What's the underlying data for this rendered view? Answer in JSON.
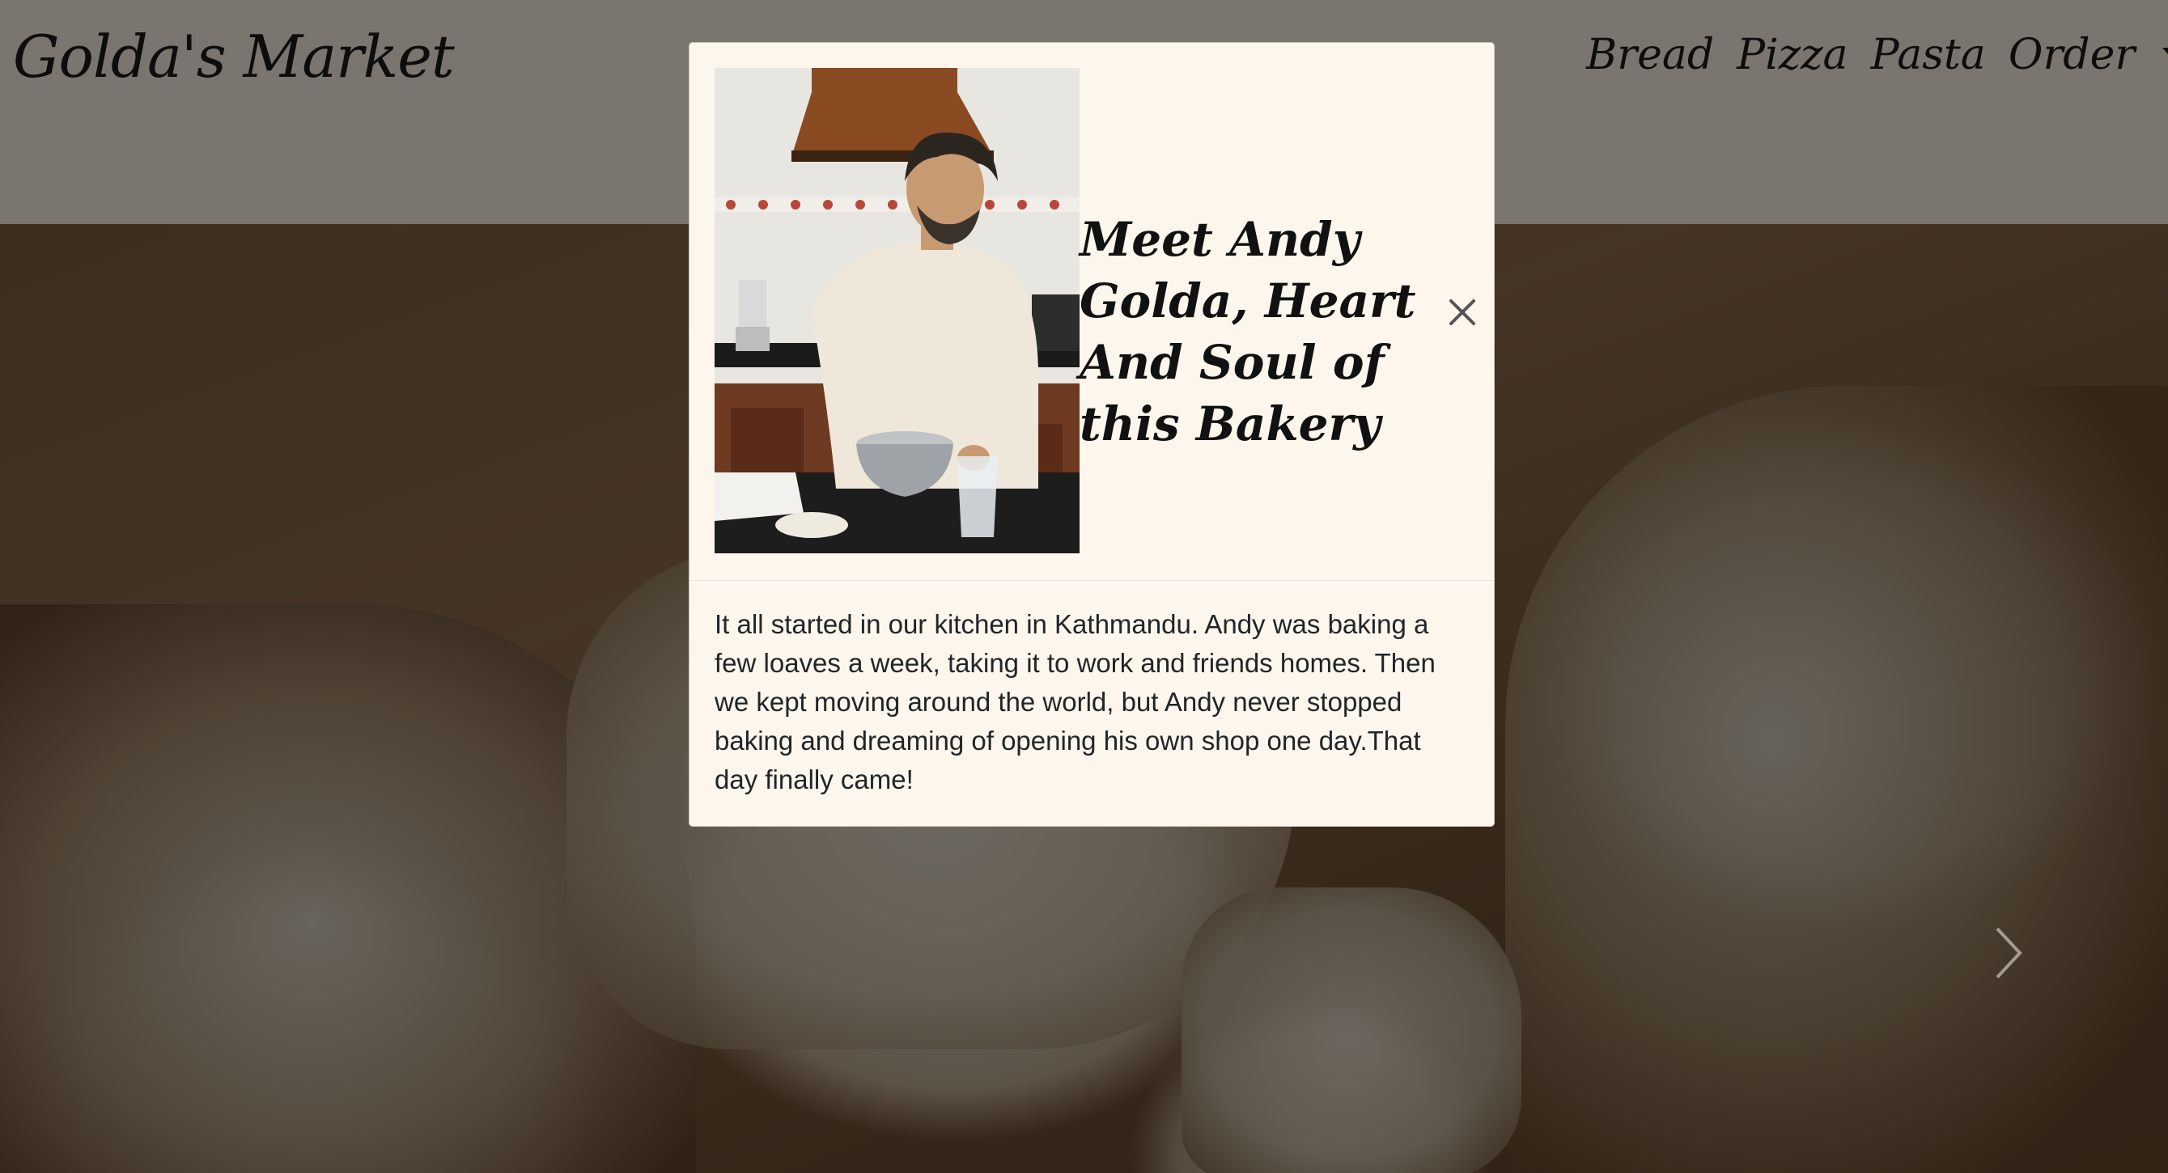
{
  "header": {
    "brand": "Golda's Market",
    "nav": [
      {
        "label": "Bread"
      },
      {
        "label": "Pizza"
      },
      {
        "label": "Pasta"
      },
      {
        "label": "Order"
      }
    ]
  },
  "modal": {
    "title": "Meet Andy Golda, Heart And Soul of this Bakery",
    "body": "It all started in our kitchen in Kathmandu. Andy was baking a few loaves a week, taking it to work and friends homes. Then we kept moving around the world, but Andy never stopped baking and dreaming of opening his own shop one day.That day finally came!",
    "close_icon": "close-icon",
    "image_subject": "man-mixing-dough-in-kitchen"
  },
  "colors": {
    "header_bg": "#f4ecde",
    "modal_bg": "#fdf6ec",
    "text": "#212529",
    "backdrop": "rgba(0,0,0,0.5)"
  }
}
